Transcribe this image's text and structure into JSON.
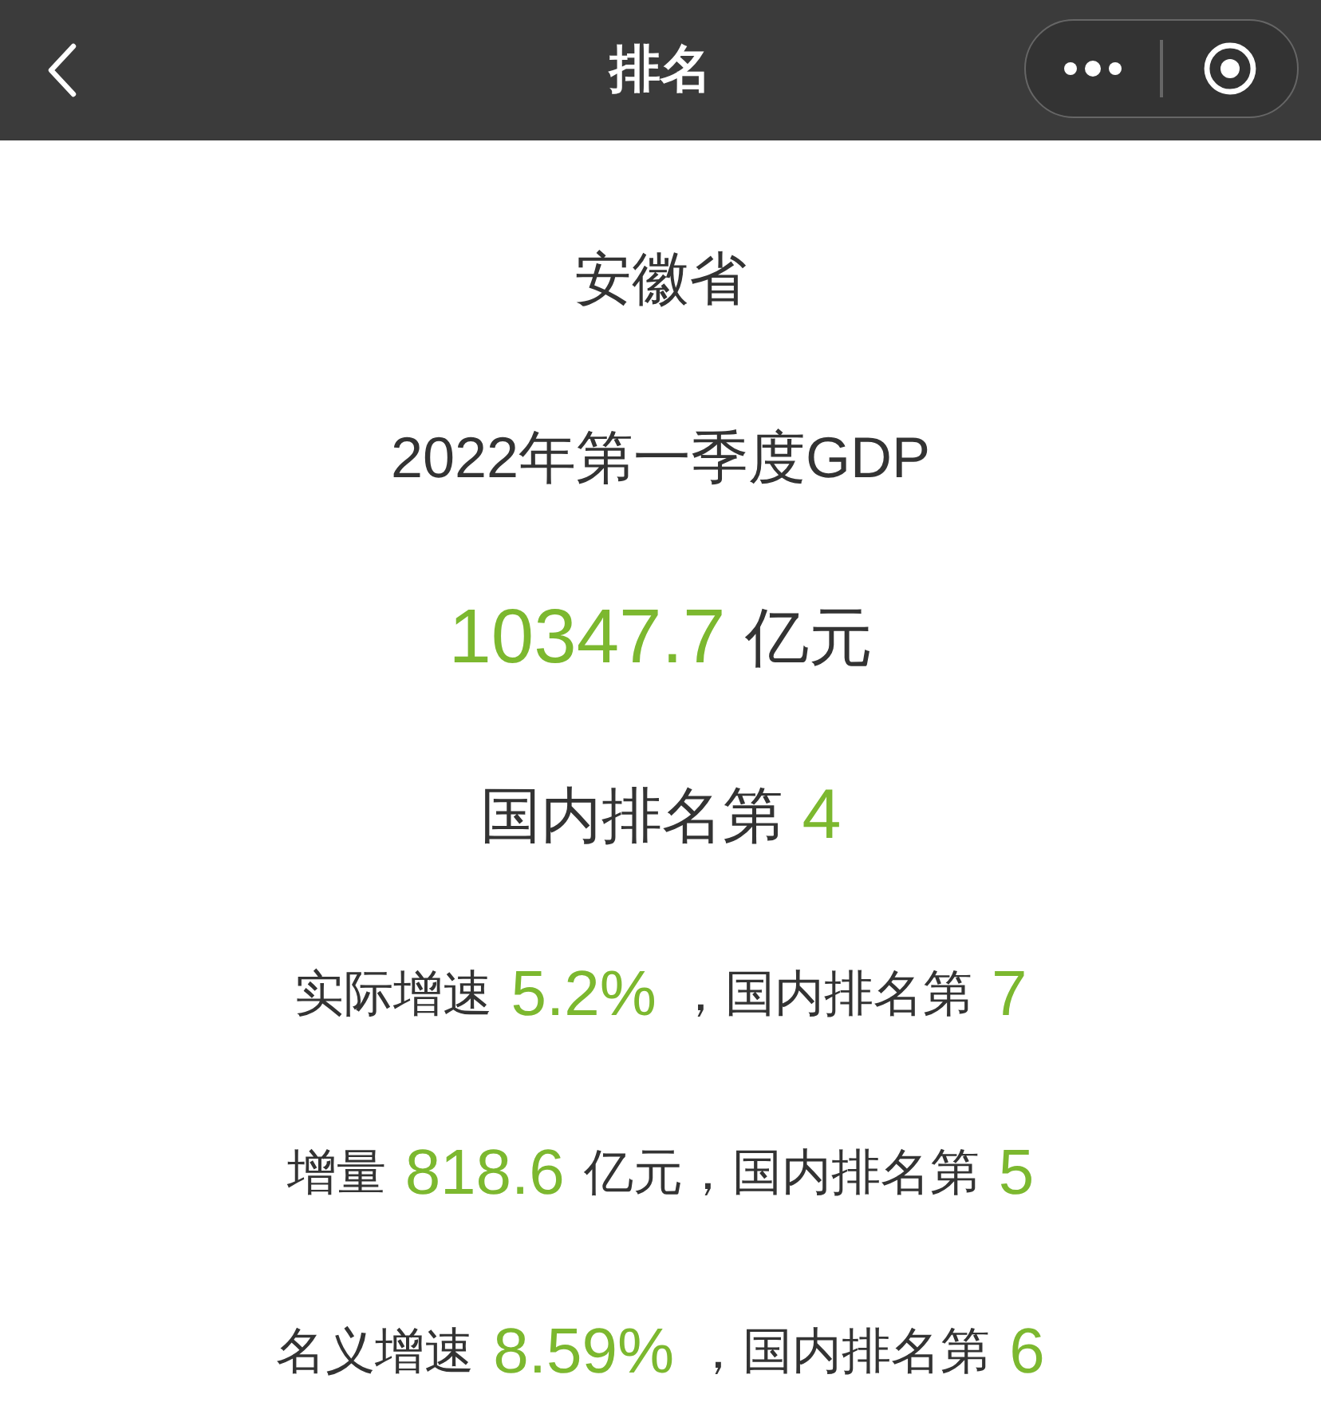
{
  "nav_bar": {
    "title": "排名"
  },
  "lines": [
    {
      "kind": "heading",
      "segments": [
        {
          "kind": "label",
          "text": "安徽省"
        }
      ]
    },
    {
      "kind": "heading",
      "segments": [
        {
          "kind": "label",
          "text": "2022年第一季度GDP"
        }
      ]
    },
    {
      "kind": "amount",
      "segments": [
        {
          "kind": "value",
          "text": "10347.7"
        },
        {
          "kind": "label",
          "text": "亿元"
        }
      ]
    },
    {
      "kind": "rank",
      "segments": [
        {
          "kind": "label",
          "text": "国内排名第"
        },
        {
          "kind": "value",
          "text": "4"
        }
      ]
    },
    {
      "kind": "stat",
      "segments": [
        {
          "kind": "label",
          "text": "实际增速"
        },
        {
          "kind": "value",
          "text": "5.2%"
        },
        {
          "kind": "label",
          "text": "，国内排名第"
        },
        {
          "kind": "value",
          "text": "7"
        }
      ]
    },
    {
      "kind": "stat",
      "segments": [
        {
          "kind": "label",
          "text": "增量"
        },
        {
          "kind": "value",
          "text": "818.6"
        },
        {
          "kind": "label",
          "text": "亿元，国内排名第"
        },
        {
          "kind": "value",
          "text": "5"
        }
      ]
    },
    {
      "kind": "stat",
      "segments": [
        {
          "kind": "label",
          "text": "名义增速"
        },
        {
          "kind": "value",
          "text": "8.59%"
        },
        {
          "kind": "label",
          "text": "，国内排名第"
        },
        {
          "kind": "value",
          "text": "6"
        }
      ]
    }
  ]
}
